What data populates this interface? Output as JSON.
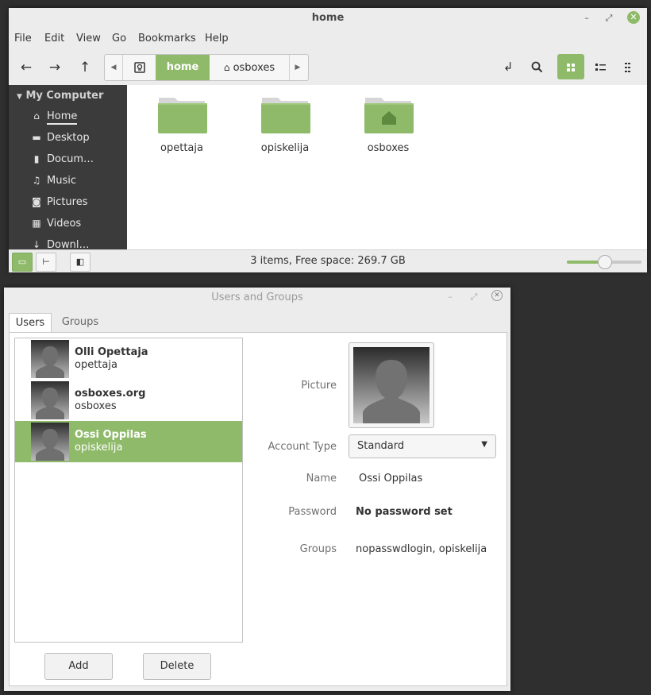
{
  "file_manager": {
    "title": "home",
    "menu": [
      "File",
      "Edit",
      "View",
      "Go",
      "Bookmarks",
      "Help"
    ],
    "path": {
      "active": "home",
      "next": "osboxes"
    },
    "sidebar": {
      "section": "My Computer",
      "items": [
        {
          "label": "Home",
          "icon": "home-icon"
        },
        {
          "label": "Desktop",
          "icon": "desktop-icon"
        },
        {
          "label": "Docum…",
          "icon": "document-icon"
        },
        {
          "label": "Music",
          "icon": "music-icon"
        },
        {
          "label": "Pictures",
          "icon": "camera-icon"
        },
        {
          "label": "Videos",
          "icon": "film-icon"
        },
        {
          "label": "Downl…",
          "icon": "download-icon"
        }
      ]
    },
    "folders": [
      {
        "name": "opettaja",
        "icon": "folder-icon"
      },
      {
        "name": "opiskelija",
        "icon": "folder-icon"
      },
      {
        "name": "osboxes",
        "icon": "home-folder-icon"
      }
    ],
    "status": "3 items, Free space: 269.7 GB",
    "zoom_fraction": 0.5
  },
  "users_groups": {
    "title": "Users and Groups",
    "tabs": [
      "Users",
      "Groups"
    ],
    "users": [
      {
        "name": "Olli Opettaja",
        "login": "opettaja"
      },
      {
        "name": "osboxes.org",
        "login": "osboxes"
      },
      {
        "name": "Ossi Oppilas",
        "login": "opiskelija"
      }
    ],
    "buttons": {
      "add": "Add",
      "delete": "Delete"
    },
    "details": {
      "picture_label": "Picture",
      "account_type_label": "Account Type",
      "account_type_value": "Standard",
      "name_label": "Name",
      "name_value": "Ossi Oppilas",
      "password_label": "Password",
      "password_value": "No password set",
      "groups_label": "Groups",
      "groups_value": "nopasswdlogin, opiskelija"
    }
  },
  "colors": {
    "accent": "#8fba6a",
    "sidebar_bg": "#3b3b3b",
    "desktop_bg": "#2f2f2f"
  }
}
